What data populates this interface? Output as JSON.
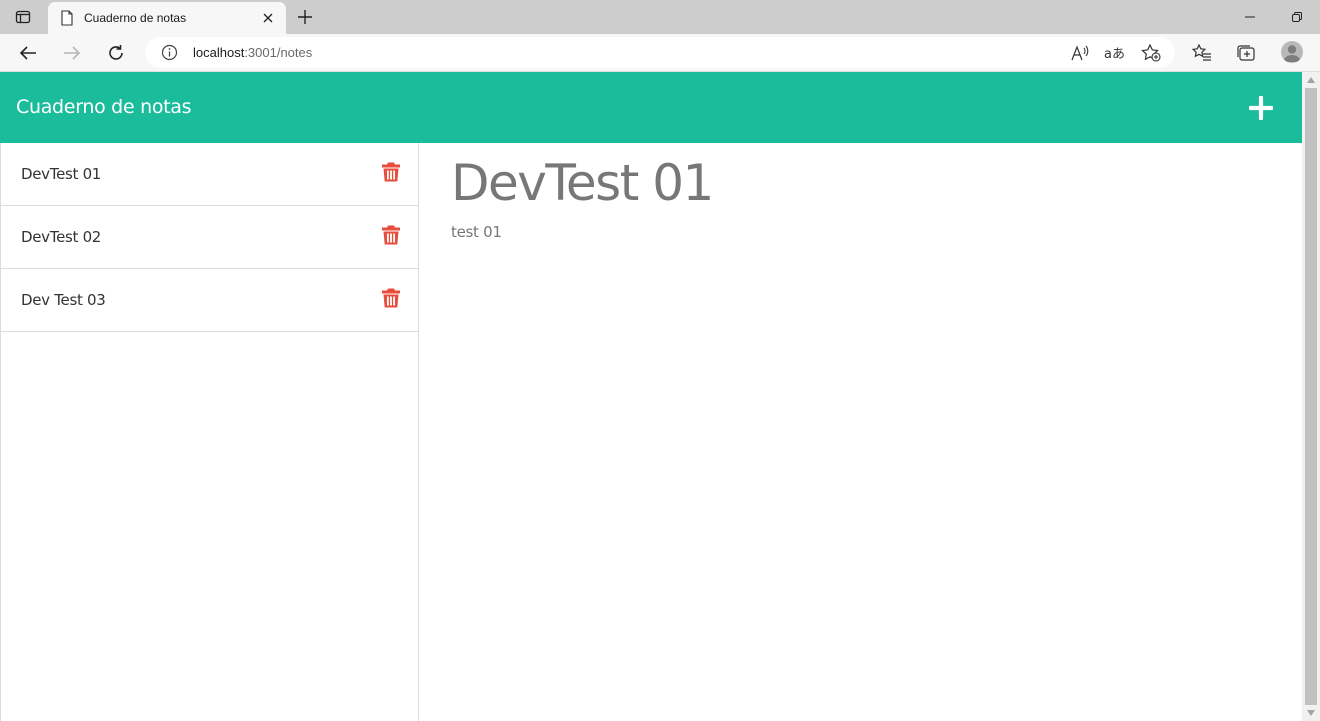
{
  "browser": {
    "tab_title": "Cuaderno de notas",
    "url_host": "localhost",
    "url_rest": ":3001/notes"
  },
  "app": {
    "title": "Cuaderno de notas",
    "accent_color": "#1abc9c",
    "delete_color": "#e74c3c"
  },
  "notes": [
    {
      "label": "DevTest 01"
    },
    {
      "label": "DevTest 02"
    },
    {
      "label": "Dev Test 03"
    }
  ],
  "selected_note": {
    "title": "DevTest 01",
    "text": "test 01"
  },
  "icons": {
    "add": "plus-icon",
    "delete": "trash-icon"
  }
}
